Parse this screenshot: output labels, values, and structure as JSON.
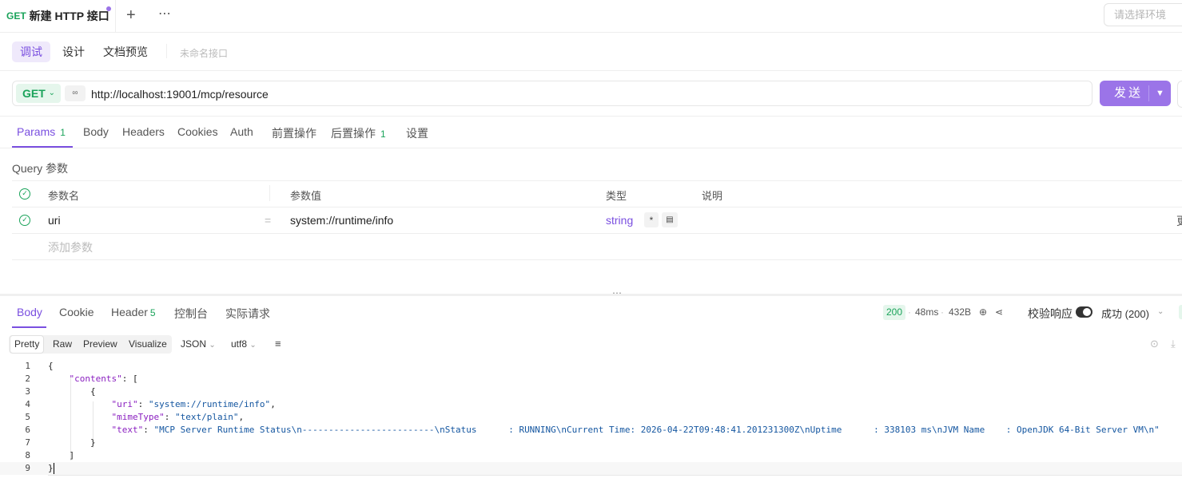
{
  "tab": {
    "method": "GET",
    "title": "新建 HTTP 接口"
  },
  "env_select": {
    "placeholder": "请选择环境"
  },
  "modes": [
    "调试",
    "设计",
    "文档预览"
  ],
  "unnamed_label": "未命名接口",
  "request": {
    "method": "GET",
    "url": "http://localhost:19001/mcp/resource",
    "send_label": "发送"
  },
  "req_tabs": [
    {
      "label": "Params",
      "badge": "1"
    },
    {
      "label": "Body"
    },
    {
      "label": "Headers"
    },
    {
      "label": "Cookies"
    },
    {
      "label": "Auth"
    },
    {
      "label": "前置操作"
    },
    {
      "label": "后置操作",
      "badge": "1"
    },
    {
      "label": "设置"
    }
  ],
  "query": {
    "section_label": "Query 参数",
    "headers": [
      "参数名",
      "参数值",
      "类型",
      "说明"
    ],
    "rows": [
      {
        "name": "uri",
        "value": "system://runtime/info",
        "type": "string",
        "required": "*"
      }
    ],
    "add_label": "添加参数",
    "edge_text": "更"
  },
  "response": {
    "tabs": [
      {
        "label": "Body"
      },
      {
        "label": "Cookie"
      },
      {
        "label": "Header",
        "badge": "5"
      },
      {
        "label": "控制台"
      },
      {
        "label": "实际请求"
      }
    ],
    "status_code": "200",
    "time": "48ms",
    "size": "432B",
    "validate_label": "校验响应",
    "validate_on": true,
    "result": "成功 (200)",
    "views": [
      "Pretty",
      "Raw",
      "Preview",
      "Visualize"
    ],
    "format": "JSON",
    "encoding": "utf8",
    "code_lines": [
      "{",
      "    \"contents\": [",
      "        {",
      "            \"uri\": \"system://runtime/info\",",
      "            \"mimeType\": \"text/plain\",",
      "            \"text\": \"MCP Server Runtime Status\\n-------------------------\\nStatus      : RUNNING\\nCurrent Time: 2026-04-22T09:48:41.201231300Z\\nUptime      : 338103 ms\\nJVM Name    : OpenJDK 64-Bit Server VM\\n\"",
      "        }",
      "    ]",
      "}"
    ]
  },
  "colors": {
    "accent": "#9b74e8",
    "accent_text": "#7a4fe0",
    "get_green": "#1aa35a"
  }
}
